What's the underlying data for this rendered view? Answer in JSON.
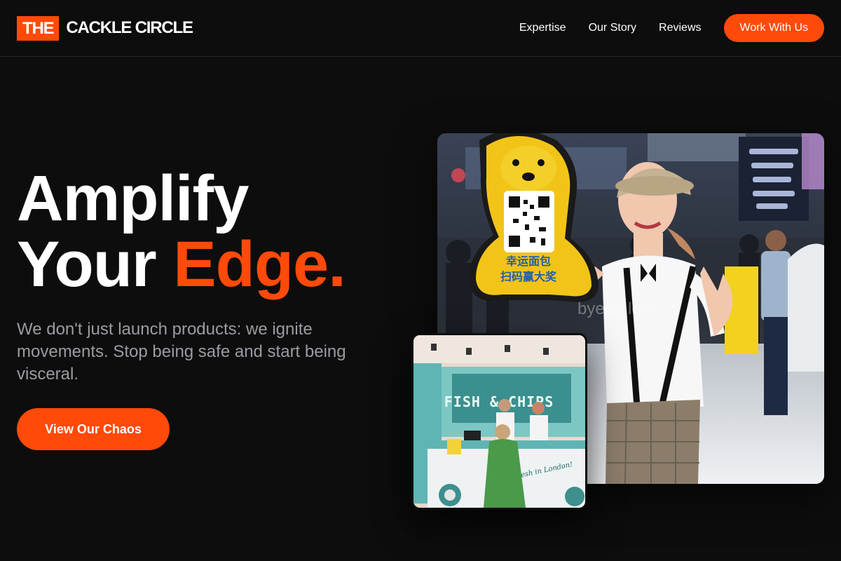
{
  "nav": {
    "logo_box": "THE",
    "logo_text": "CACKLE CIRCLE",
    "links": [
      "Expertise",
      "Our Story",
      "Reviews"
    ],
    "cta": "Work With Us"
  },
  "hero": {
    "headline_line1": "Amplify",
    "headline_line2_a": "Your ",
    "headline_line2_b": "Edge.",
    "subtext": "We don't just launch products: we ignite movements. Stop being safe and start being visceral.",
    "cta": "View Our Chaos"
  },
  "photos": {
    "main_sign_line1": "幸运面包",
    "main_sign_line2": "扫码赢大奖",
    "main_watermark": "byena.love",
    "small_sign": "FISH & CHIPS",
    "small_truck_text": "Fresh in London!"
  },
  "colors": {
    "accent": "#ff4a0a",
    "background": "#0d0d0d",
    "subtext": "#9b9ba3"
  }
}
